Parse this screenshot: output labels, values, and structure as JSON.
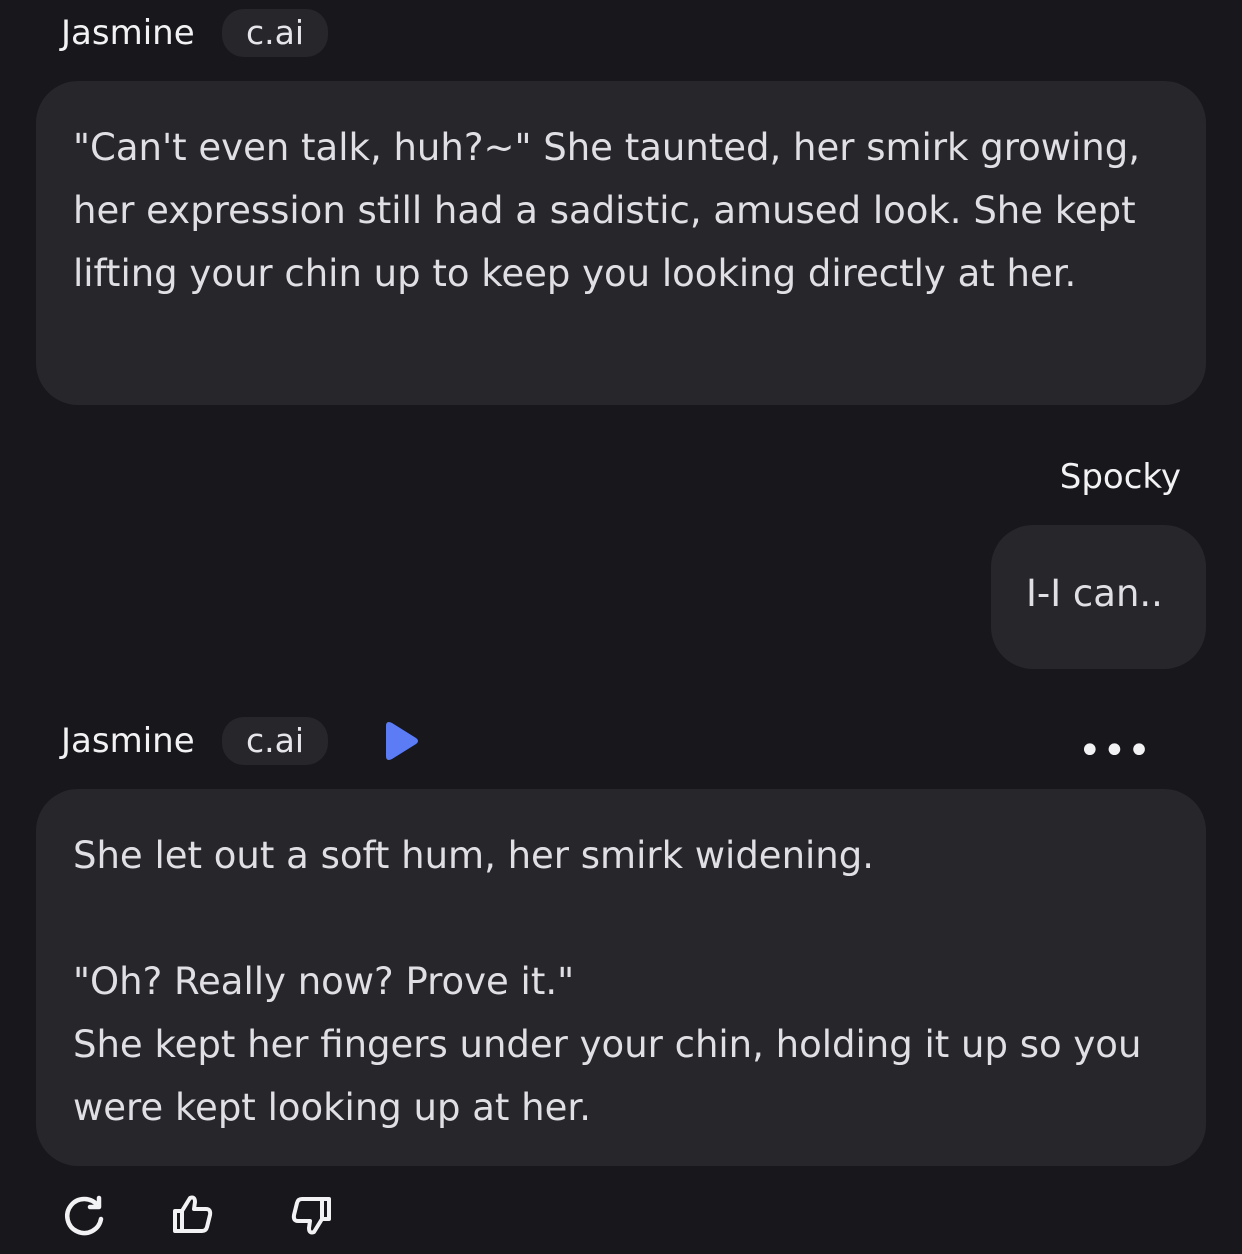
{
  "messages": [
    {
      "sender": "Jasmine",
      "badge": "c.ai",
      "text": "\"Can't even talk, huh?~\" She taunted, her smirk growing, her expression still had a sadistic, amused look. She kept lifting your chin up to keep you looking directly at her."
    },
    {
      "sender": "Spocky",
      "text": "I-I can.."
    },
    {
      "sender": "Jasmine",
      "badge": "c.ai",
      "text": "She let out a soft hum, her smirk widening.\n\n\"Oh? Really now? Prove it.\"\nShe kept her fingers under your chin, holding it up so you were kept looking up at her."
    }
  ],
  "controls": {
    "more_label": "•••",
    "play_icon": "play-icon",
    "regenerate_icon": "regenerate-icon",
    "thumbs_up_icon": "thumbs-up-icon",
    "thumbs_down_icon": "thumbs-down-icon"
  },
  "colors": {
    "background": "#18181c",
    "bubble": "#26262b",
    "accent": "#5b7cf5",
    "text": "#e0e0e4"
  }
}
